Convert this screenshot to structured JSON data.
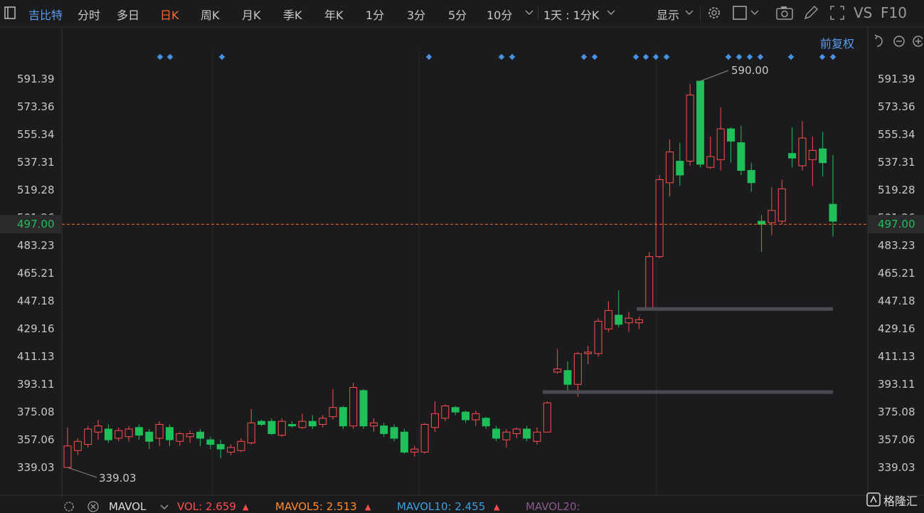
{
  "toolbar": {
    "stock_name": "吉比特",
    "periods": [
      "分时",
      "多日",
      "日K",
      "周K",
      "月K",
      "季K",
      "年K",
      "1分",
      "3分",
      "5分",
      "10分"
    ],
    "active_period": "日K",
    "range_label": "1天 : 1分K",
    "display_label": "显示",
    "vs_label": "VS",
    "f10_label": "F10",
    "adjust_label": "前复权"
  },
  "colors": {
    "up": "#ff4d4d",
    "down": "#1fbf5a",
    "accent": "#ff6a2b",
    "blue": "#5a9cf0"
  },
  "chart_data": {
    "type": "candlestick",
    "y_ticks": [
      "591.39",
      "573.36",
      "555.34",
      "537.31",
      "519.28",
      "501.26",
      "483.23",
      "465.21",
      "447.18",
      "429.16",
      "411.13",
      "393.11",
      "375.08",
      "357.06",
      "339.03"
    ],
    "ylim": [
      339.03,
      591.39
    ],
    "current_price": "497.00",
    "high_label": "590.00",
    "low_label": "339.03",
    "support_levels": [
      442,
      388
    ],
    "candles": [
      [
        339.03,
        353,
        339.03,
        365
      ],
      [
        350,
        356,
        347,
        358
      ],
      [
        354,
        364,
        352,
        366
      ],
      [
        362,
        366,
        357,
        370
      ],
      [
        364,
        357,
        355,
        367
      ],
      [
        358,
        363,
        356,
        365
      ],
      [
        359,
        364,
        356,
        366
      ],
      [
        365,
        360,
        357,
        367
      ],
      [
        362,
        356,
        351,
        364
      ],
      [
        358,
        367,
        353,
        369
      ],
      [
        365,
        357,
        353,
        367
      ],
      [
        356,
        361,
        353,
        362
      ],
      [
        359,
        361,
        355,
        363
      ],
      [
        362,
        358,
        353,
        364
      ],
      [
        357,
        354,
        351,
        359
      ],
      [
        354,
        351,
        345,
        357
      ],
      [
        349,
        352,
        347,
        354
      ],
      [
        350,
        356,
        349,
        358
      ],
      [
        355,
        368,
        354,
        377
      ],
      [
        369,
        367,
        366,
        370
      ],
      [
        369,
        361,
        360,
        371
      ],
      [
        360,
        369,
        359,
        371
      ],
      [
        367,
        366,
        365,
        369
      ],
      [
        365,
        369,
        364,
        374
      ],
      [
        369,
        366,
        364,
        373
      ],
      [
        367,
        371,
        365,
        373
      ],
      [
        372,
        378,
        370,
        390
      ],
      [
        378,
        366,
        364,
        379
      ],
      [
        366,
        391,
        364,
        394
      ],
      [
        389,
        366,
        364,
        390
      ],
      [
        366,
        368,
        362,
        371
      ],
      [
        366,
        361,
        359,
        368
      ],
      [
        365,
        358,
        356,
        367
      ],
      [
        362,
        349,
        348,
        364
      ],
      [
        349,
        351,
        346,
        353
      ],
      [
        349,
        367,
        348,
        368
      ],
      [
        365,
        374,
        362,
        382
      ],
      [
        371,
        379,
        369,
        380
      ],
      [
        378,
        375,
        373,
        379
      ],
      [
        375,
        370,
        368,
        376
      ],
      [
        370,
        374,
        366,
        376
      ],
      [
        371,
        366,
        364,
        372
      ],
      [
        364,
        358,
        356,
        366
      ],
      [
        357,
        362,
        352,
        364
      ],
      [
        361,
        364,
        358,
        365
      ],
      [
        364,
        358,
        356,
        366
      ],
      [
        356,
        362,
        354,
        365
      ],
      [
        362,
        381,
        362,
        382
      ],
      [
        401,
        403,
        400,
        416
      ],
      [
        402,
        393,
        389,
        408
      ],
      [
        393,
        413,
        385,
        414
      ],
      [
        413,
        414,
        406,
        418
      ],
      [
        413,
        434,
        411,
        436
      ],
      [
        429,
        441,
        427,
        447
      ],
      [
        438,
        432,
        430,
        454
      ],
      [
        433,
        436,
        427,
        440
      ],
      [
        433,
        435,
        429,
        437
      ],
      [
        442,
        476,
        442,
        479
      ],
      [
        476,
        526,
        475,
        529
      ],
      [
        524,
        544,
        515,
        552
      ],
      [
        538,
        529,
        522,
        550
      ],
      [
        538,
        581,
        535,
        588
      ],
      [
        590,
        536,
        534,
        590
      ],
      [
        534,
        541,
        533,
        554
      ],
      [
        539,
        559,
        532,
        573
      ],
      [
        559,
        551,
        537,
        560
      ],
      [
        550,
        532,
        529,
        561
      ],
      [
        532,
        524,
        518,
        537
      ],
      [
        499,
        497,
        479,
        503
      ],
      [
        498,
        506,
        490,
        521
      ],
      [
        499,
        520,
        497,
        526
      ],
      [
        543,
        540,
        534,
        560
      ],
      [
        535,
        553,
        532,
        564
      ],
      [
        539,
        545,
        522,
        554
      ],
      [
        546,
        537,
        528,
        557
      ],
      [
        510,
        499,
        489,
        542
      ]
    ],
    "legend": {
      "indicator": "MAVOL",
      "vol": "VOL: 2.659",
      "mavol5": "MAVOL5: 2.513",
      "mavol10": "MAVOL10: 2.455",
      "mavol20": "MAVOL20:"
    }
  },
  "watermark": "格隆汇"
}
